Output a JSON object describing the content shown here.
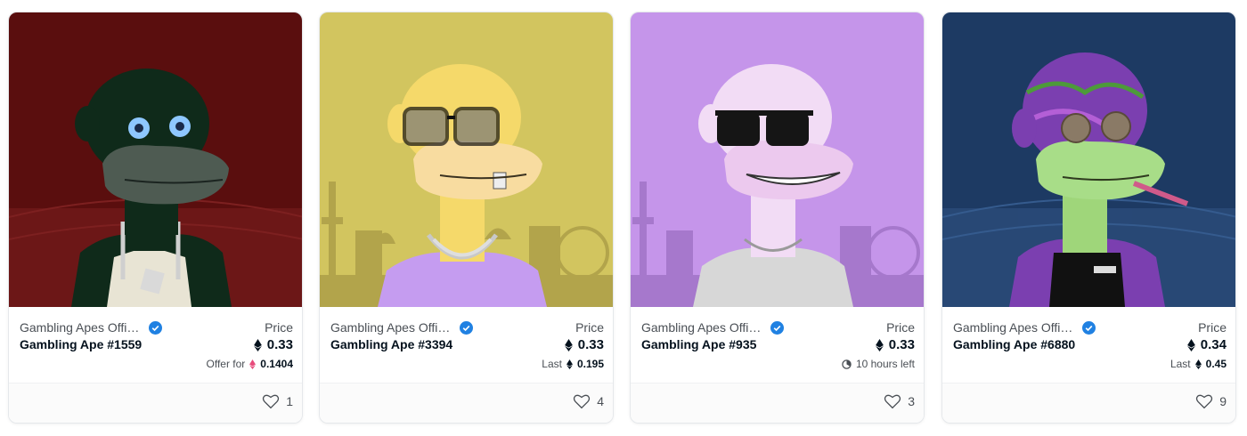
{
  "colors": {
    "card_border": "#e5e8eb",
    "verified_blue": "#2081e2",
    "offer_pink": "#e74c7c",
    "bg_card1": "#5a0e0e",
    "bg_card2": "#d2c55f",
    "bg_card3": "#c595ea",
    "bg_card4": "#1d3a63"
  },
  "cards": [
    {
      "collection": "Gambling Apes Official",
      "name": "Gambling Ape #1559",
      "price_label": "Price",
      "price": "0.33",
      "sub_label": "Offer for",
      "sub_value": "0.1404",
      "sub_icon": "eth-pink-icon",
      "likes": "1"
    },
    {
      "collection": "Gambling Apes Official",
      "name": "Gambling Ape #3394",
      "price_label": "Price",
      "price": "0.33",
      "sub_label": "Last",
      "sub_value": "0.195",
      "sub_icon": "eth-icon",
      "likes": "4"
    },
    {
      "collection": "Gambling Apes Official",
      "name": "Gambling Ape #935",
      "price_label": "Price",
      "price": "0.33",
      "sub_label": "10 hours left",
      "sub_value": "",
      "sub_icon": "clock-icon",
      "likes": "3"
    },
    {
      "collection": "Gambling Apes Official",
      "name": "Gambling Ape #6880",
      "price_label": "Price",
      "price": "0.34",
      "sub_label": "Last",
      "sub_value": "0.45",
      "sub_icon": "eth-icon",
      "likes": "9"
    }
  ]
}
